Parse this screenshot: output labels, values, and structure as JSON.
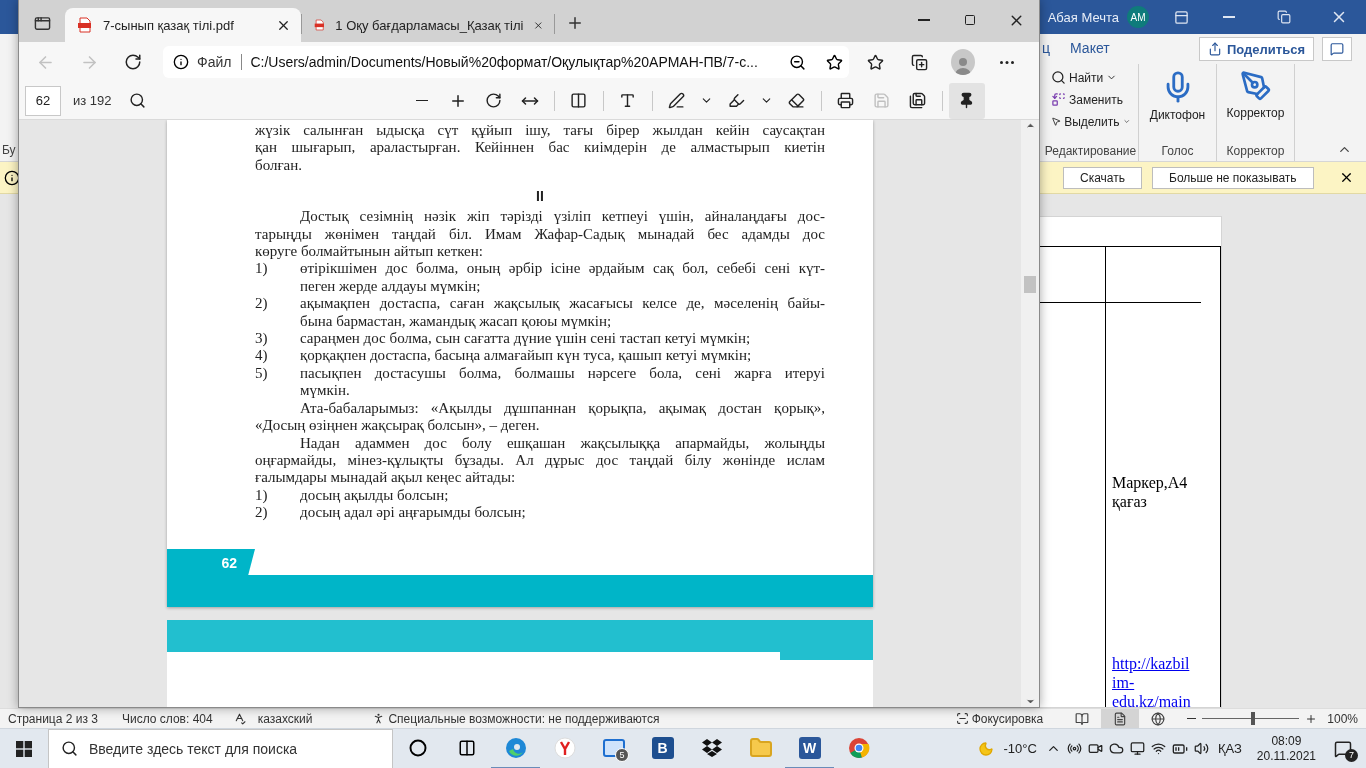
{
  "word": {
    "account_name": "Абая Мечта",
    "avatar": "AM",
    "ribbon_tabs": [
      {
        "label": "ц",
        "selected": false
      },
      {
        "label": "Макет",
        "selected": false
      }
    ],
    "share_button": "Поделиться",
    "cut_group_label": "Бу",
    "groups": [
      {
        "kind": "list",
        "label": "Редактирование",
        "commands": [
          {
            "kind": "find",
            "label": "Найти",
            "menu": true
          },
          {
            "kind": "replace",
            "label": "Заменить",
            "menu": false
          },
          {
            "kind": "select",
            "label": "Выделить",
            "menu": true
          }
        ]
      },
      {
        "kind": "big",
        "label": "Голос",
        "command": {
          "kind": "mic",
          "label": "Диктофон"
        }
      },
      {
        "kind": "big",
        "label": "Корректор",
        "command": {
          "kind": "pen",
          "label": "Корректор"
        }
      }
    ],
    "message_bar": {
      "buttons": [
        "Скачать",
        "Больше не показывать"
      ]
    },
    "table": {
      "material": "Маркер,А4 қағаз",
      "link": "http://kazbilim-edu.kz/main"
    },
    "status_bar": {
      "page": "Страница 2 из 3",
      "words": "Число слов: 404",
      "language": "казахский",
      "accessibility": "Специальные возможности: не поддерживаются",
      "focus": "Фокусировка",
      "views": [
        {
          "kind": "read",
          "selected": false
        },
        {
          "kind": "print",
          "selected": true
        },
        {
          "kind": "web",
          "selected": false
        }
      ],
      "zoom": {
        "level": 0.52,
        "reading": "100%"
      }
    }
  },
  "browser": {
    "tabs": [
      {
        "title": "7-сынып қазақ тілі.pdf",
        "selected": true
      },
      {
        "title": "1 Оқу бағдарламасы_Қазақ тілі",
        "selected": false
      }
    ],
    "nav": [
      {
        "kind": "back",
        "disabled": true
      },
      {
        "kind": "forward",
        "disabled": true
      },
      {
        "kind": "refresh",
        "disabled": false
      }
    ],
    "address": {
      "scheme": "Файл",
      "url": "C:/Users/admin/Documents/Новый%20формат/Оқулықтар%20АРМАН-ПВ/7-с..."
    },
    "pdf_toolbar": {
      "page": "62",
      "total": "из 192",
      "tool_groups": [
        [
          {
            "kind": "zoom-out",
            "disabled": false,
            "selected": false
          },
          {
            "kind": "zoom-in",
            "disabled": false,
            "selected": false
          },
          {
            "kind": "rotate",
            "disabled": false,
            "selected": false
          },
          {
            "kind": "fit",
            "disabled": false,
            "selected": false
          }
        ],
        [
          {
            "kind": "page-view",
            "disabled": false,
            "selected": false
          }
        ],
        [
          {
            "kind": "read-aloud",
            "disabled": false,
            "selected": false
          }
        ],
        [
          {
            "kind": "draw",
            "disabled": false,
            "selected": false
          },
          {
            "kind": "menu",
            "disabled": false,
            "selected": false
          },
          {
            "kind": "highlight",
            "disabled": false,
            "selected": false
          },
          {
            "kind": "menu",
            "disabled": false,
            "selected": false
          },
          {
            "kind": "erase",
            "disabled": false,
            "selected": false
          }
        ],
        [
          {
            "kind": "print",
            "disabled": false,
            "selected": false
          },
          {
            "kind": "save",
            "disabled": true,
            "selected": false
          },
          {
            "kind": "save-as",
            "disabled": false,
            "selected": false
          }
        ],
        [
          {
            "kind": "pin",
            "disabled": false,
            "selected": true
          }
        ]
      ]
    },
    "document": {
      "blocks": [
        {
          "kind": "paragraph",
          "indent": false,
          "lines": [
            "жүзік салынған ыдысқа сүт құйып ішу, тағы бірер жылдан кейін саусақтан",
            "қан шығарып, араластырған. Кейіннен бас киімдерін де алмастырып киетін",
            "болған."
          ]
        },
        {
          "kind": "heading",
          "text": "II"
        },
        {
          "kind": "paragraph",
          "indent": true,
          "lines": [
            "Достық сезімнің нәзік жіп тәрізді үзіліп кетпеуі үшін, айналаңдағы дос-",
            "тарыңды жөнімен таңдай біл. Имам Жафар-Садық мынадай бес адамды дос",
            "көруге болмайтынын айтып кеткен:"
          ]
        },
        {
          "kind": "item",
          "number": "1)",
          "lines": [
            "өтірікшімен дос болма, оның әрбір ісіне әрдайым сақ бол, себебі сені күт-",
            "пеген жерде алдауы мүмкін;"
          ]
        },
        {
          "kind": "item",
          "number": "2)",
          "lines": [
            "ақымақпен достаспа, саған жақсылық жасағысы келсе де, мәселенің байы-",
            "бына бармастан, жамандық жасап қоюы мүмкін;"
          ]
        },
        {
          "kind": "item",
          "number": "3)",
          "lines": [
            "сараңмен дос болма, сын сағатта дүние үшін сені тастап кетуі мүмкін;"
          ]
        },
        {
          "kind": "item",
          "number": "4)",
          "lines": [
            "қорқақпен достаспа, басыңа алмағайып күн туса, қашып кетуі мүмкін;"
          ]
        },
        {
          "kind": "item",
          "number": "5)",
          "lines": [
            "пасықпен достасушы болма, болмашы нәрсеге бола, сені жарға итеруі",
            "мүмкін."
          ]
        },
        {
          "kind": "paragraph",
          "indent": true,
          "lines": [
            "Ата-бабаларымыз: «Ақылды дұшпаннан қорықпа, ақымақ достан қорық»,",
            "«Досың өзіңнен жақсырақ болсын», – деген."
          ]
        },
        {
          "kind": "paragraph",
          "indent": true,
          "lines": [
            "Надан адаммен дос болу ешқашан жақсылыққа апармайды, жолыңды",
            "оңғармайды, мінез-құлықты бұзады. Ал дұрыс дос таңдай білу жөнінде ислам",
            "ғалымдары мынадай ақыл кеңес айтады:"
          ]
        },
        {
          "kind": "item",
          "number": "1)",
          "lines": [
            "досың ақылды болсын;"
          ]
        },
        {
          "kind": "item",
          "number": "2)",
          "lines": [
            "досың адал әрі аңғарымды болсын;"
          ]
        }
      ],
      "page_number": "62"
    }
  },
  "taskbar": {
    "search": {
      "placeholder": "Введите здесь текст для поиска"
    },
    "apps": [
      {
        "kind": "cortana",
        "running": false
      },
      {
        "kind": "task-view",
        "running": false
      },
      {
        "kind": "edge",
        "running": true
      },
      {
        "kind": "yandex",
        "running": false
      },
      {
        "kind": "mail",
        "running": false,
        "badge": "5"
      },
      {
        "kind": "letter",
        "running": false,
        "glyph": "B"
      },
      {
        "kind": "dropbox",
        "running": false
      },
      {
        "kind": "explorer",
        "running": false
      },
      {
        "kind": "word",
        "running": true,
        "glyph": "W"
      },
      {
        "kind": "chrome",
        "running": false
      }
    ],
    "weather": "-10°C",
    "language": "ҚАЗ",
    "time": "08:09",
    "date": "20.11.2021",
    "notifications": "7"
  }
}
